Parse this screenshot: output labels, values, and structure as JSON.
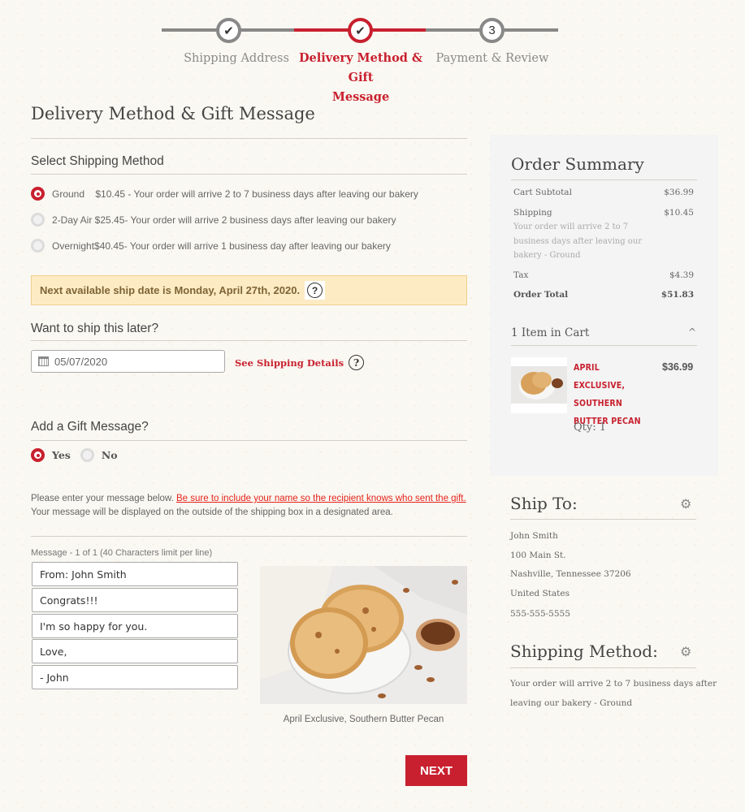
{
  "stepper": {
    "steps": [
      {
        "label": "Shipping Address",
        "marker": "✔",
        "state": "complete"
      },
      {
        "label_line1": "Delivery Method & Gift",
        "label_line2": "Message",
        "marker": "✔",
        "state": "active"
      },
      {
        "label": "Payment & Review",
        "marker": "3",
        "state": "upcoming"
      }
    ]
  },
  "page_title": "Delivery Method & Gift Message",
  "shipping_method": {
    "title": "Select Shipping Method",
    "options": [
      {
        "name": "Ground",
        "text": "Ground    $10.45 - Your order will arrive 2 to 7 business days after leaving our bakery",
        "checked": true
      },
      {
        "name": "2-Day Air",
        "text": "2-Day Air $25.45- Your order will arrive 2 business days after leaving our bakery",
        "checked": false
      },
      {
        "name": "Overnight",
        "text": "Overnight$40.45- Your order will arrive 1 business day after leaving our bakery",
        "checked": false
      }
    ]
  },
  "notice": {
    "text": "Next available ship date is Monday, April 27th, 2020.",
    "help_icon": "?"
  },
  "ship_later": {
    "title": "Want to ship this later?",
    "date_value": "05/07/2020",
    "details_link": "See Shipping Details",
    "help_icon": "?"
  },
  "gift": {
    "title": "Add a Gift Message?",
    "options": [
      {
        "label": "Yes",
        "checked": true
      },
      {
        "label": "No",
        "checked": false
      }
    ],
    "info_prefix": "Please enter your message below. ",
    "info_warning": "Be sure to include your name so the recipient knows who sent the gift. ",
    "info_suffix": "Your message will be displayed on the outside of the shipping box in a designated area.",
    "message_label": "Message - 1 of 1 (40 Characters limit per line)",
    "lines": [
      "From: John Smith",
      "Congrats!!!",
      "I'm so happy for you.",
      "Love,",
      "- John"
    ],
    "photo_caption": "April Exclusive, Southern Butter Pecan"
  },
  "next_button": "NEXT",
  "summary": {
    "title": "Order Summary",
    "rows": [
      {
        "label": "Cart Subtotal",
        "value": "$36.99"
      },
      {
        "label": "Shipping",
        "value": "$10.45"
      },
      {
        "label": "Tax",
        "value": "$4.39"
      },
      {
        "label": "Order Total",
        "value": "$51.83"
      }
    ],
    "shipping_note": "Your order will arrive 2 to 7 business days after leaving our bakery - Ground",
    "cart_header": "1 Item in Cart",
    "cart_toggle_icon": "^",
    "item": {
      "name": "APRIL EXCLUSIVE, SOUTHERN BUTTER PECAN",
      "price": "$36.99",
      "qty": "Qty: 1"
    }
  },
  "ship_to": {
    "title": "Ship To:",
    "lines": [
      "John Smith",
      "100 Main St.",
      "Nashville, Tennessee 37206",
      "United States",
      "555-555-5555"
    ]
  },
  "shipping_method_summary": {
    "title": "Shipping Method:",
    "line1": "Your order will arrive 2 to 7 business days after",
    "line2": "leaving our bakery - Ground"
  },
  "colors": {
    "brand_red": "#c8202f",
    "notice_bg": "#fdebc3",
    "warning_red": "#e5231b",
    "panel_bg": "#f4f4f4"
  }
}
